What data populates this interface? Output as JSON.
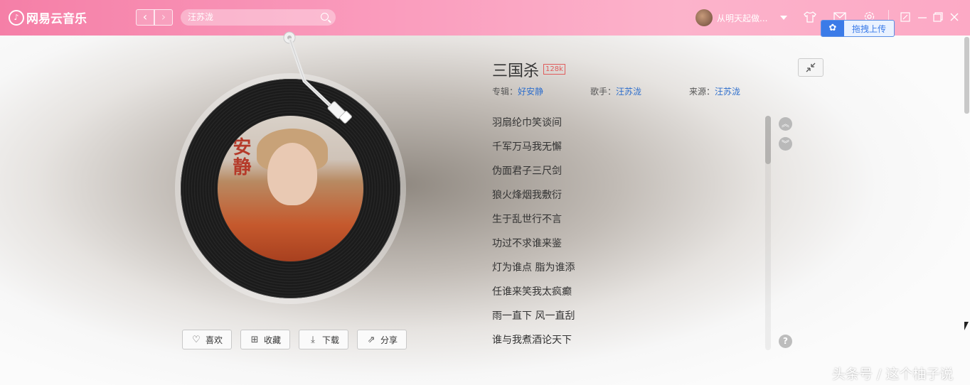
{
  "app": {
    "name": "网易云音乐"
  },
  "nav": {
    "back": "‹",
    "forward": "›"
  },
  "search": {
    "value": "汪苏泷"
  },
  "user": {
    "name": "从明天起做..."
  },
  "header_icons": [
    "skin-icon",
    "mail-icon",
    "settings-icon",
    "mini-mode-icon",
    "minimize-icon",
    "maximize-icon",
    "close-icon"
  ],
  "upload": {
    "label": "拖拽上传"
  },
  "song": {
    "title": "三国杀",
    "quality": "128k",
    "album_label": "专辑：",
    "album": "好安静",
    "artist_label": "歌手：",
    "artist": "汪苏泷",
    "source_label": "来源：",
    "source": "汪苏泷"
  },
  "cover_text": "安静",
  "lyrics": [
    "羽扇纶巾笑谈间",
    "千军万马我无懈",
    "伪面君子三尺剑",
    "狼火烽烟我敷衍",
    "生于乱世行不言",
    "功过不求谁来鉴",
    "灯为谁点 脂为谁添",
    "任谁来笑我太疯癫",
    "雨一直下 风一直刮",
    "谁与我煮酒论天下"
  ],
  "actions": {
    "like": "喜欢",
    "collect": "收藏",
    "download": "下载",
    "share": "分享"
  },
  "help": "?",
  "watermark": "头条号 / 这个柚子说"
}
